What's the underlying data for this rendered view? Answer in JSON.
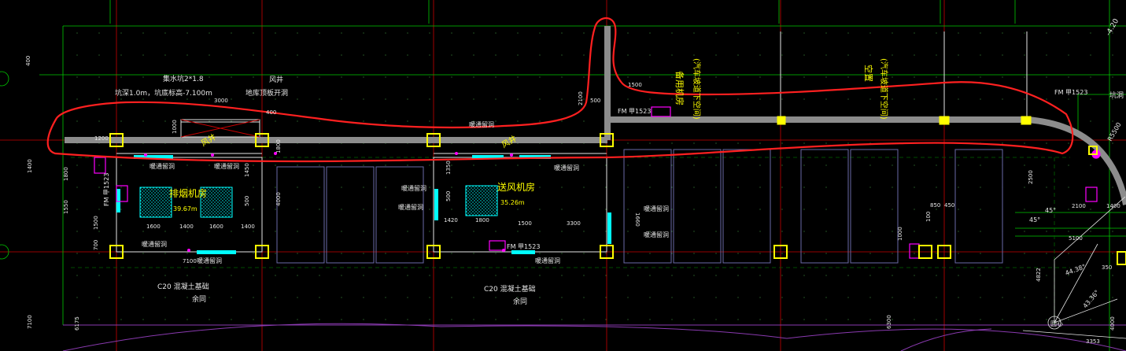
{
  "colors": {
    "background": "#000000",
    "grid_green": "#00c800",
    "axis_red": "#c80000",
    "wall_gray": "#8c8c8c",
    "column_yellow": "#ffff00",
    "dim_white": "#e6e6e6",
    "room_label_yellow": "#ffff00",
    "hatch_cyan": "#00ffff",
    "magenta": "#ff00ff",
    "markup_red": "#ff2020",
    "dashed_dark_green": "#006400"
  },
  "labels": {
    "sump_note": "集水坑2*1.8",
    "pit_depth_note": "坑深1.0m，坑底标高-7.100m",
    "air_shaft_top": "风井",
    "floor_opening_note": "地库顶板开洞",
    "smoke_room": "排烟机房",
    "smoke_room_area": "39.67m",
    "supply_room": "送风机房",
    "supply_room_area": "35.26m",
    "spare_room_1": "备用机房",
    "spare_room_1_note": "(汽车坡道下空间)",
    "spare_room_2": "空置",
    "spare_room_2_note": "(汽车坡道下空间)",
    "air_shaft_left": "风井",
    "air_shaft_mid": "风井",
    "foundation_left": "C20 混凝土基础",
    "same_left": "余同",
    "foundation_mid": "C20 混凝土基础",
    "same_mid": "余同",
    "door_fm1": "FM 甲1523",
    "door_fm2": "FM 甲1523",
    "door_fm3": "FM 甲1523",
    "door_fm4": "FM 甲1523",
    "pit_right": "坑洞",
    "elev_right": "-4.20",
    "radius_note": "R5500",
    "circle_center": "圆心",
    "angle_1": "44.38°",
    "angle_2": "43.36°",
    "angle_3": "45°",
    "angle_4": "45°",
    "hv_1": "暖通留洞",
    "hv_2": "暖通留洞",
    "hv_3": "暖通留洞",
    "hv_4": "暖通留洞",
    "hv_5": "暖通留洞",
    "hv_6": "暖通留洞",
    "hv_7": "暖通留洞",
    "hv_8": "暖通留洞",
    "hv_9": "暖通留洞",
    "hv_10": "暖通留洞",
    "hv_11": "暖通留洞"
  },
  "dims": {
    "d400": "400",
    "d1400v": "1400",
    "d1200": "1200",
    "d1800v": "1800",
    "d1550": "1550",
    "d1500v": "1500",
    "d700": "700",
    "d7100": "7100",
    "d1600a": "1600",
    "d1400a": "1400",
    "d1600b": "1600",
    "d1400b": "1400",
    "d3000": "3000",
    "d400b": "400",
    "d1000": "1000",
    "d1450": "1450",
    "d500a": "500",
    "d4000": "4000",
    "d1800b": "1800",
    "d1350": "1350",
    "d500b": "500",
    "d1420": "1420",
    "d1800c": "1800",
    "d1500": "1500",
    "d3300": "3300",
    "d2100a": "2100",
    "d500c": "500",
    "d1500c": "1500",
    "d1660": "1660",
    "d850": "850",
    "d450": "450",
    "d100": "100",
    "d1000b": "1000",
    "d2500": "2500",
    "d2100b": "2100",
    "d1400c": "1400",
    "d5100": "5100",
    "d4822": "4822",
    "d6300": "6300",
    "d3353": "3353",
    "d4000b": "4000",
    "d7100b": "7100",
    "d6175": "6175",
    "d350": "350"
  }
}
